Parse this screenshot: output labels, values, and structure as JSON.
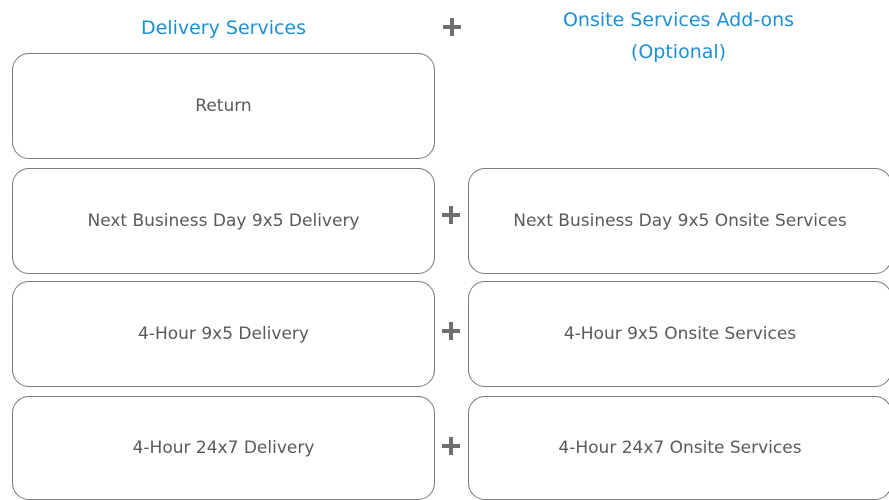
{
  "headings": {
    "delivery": "Delivery Services",
    "onsite_line1": "Onsite Services Add-ons",
    "onsite_line2": "(Optional)"
  },
  "delivery_services": [
    "Return",
    "Next Business Day 9x5 Delivery",
    "4-Hour 9x5 Delivery",
    "4-Hour 24x7 Delivery"
  ],
  "onsite_services": [
    "Next Business Day 9x5 Onsite Services",
    "4-Hour 9x5 Onsite Services",
    "4-Hour 24x7 Onsite Services"
  ],
  "colors": {
    "heading": "#1e8fd6",
    "box_border": "#7a7a7a",
    "box_text": "#595959",
    "plus": "#6f6f6f"
  },
  "icons": {
    "combine": "plus-icon"
  }
}
